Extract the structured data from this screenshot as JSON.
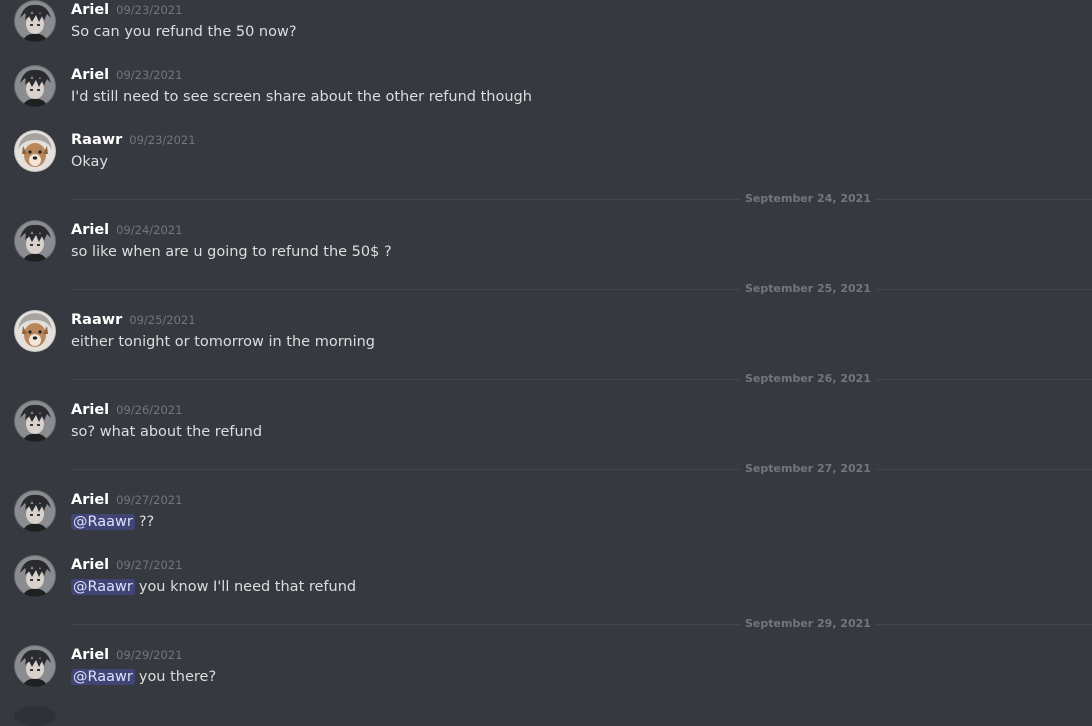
{
  "users": {
    "ariel": "Ariel",
    "raawr": "Raawr"
  },
  "messages": [
    {
      "author": "Ariel",
      "time": "09/23/2021",
      "text": "So can you refund the 50 now?"
    },
    {
      "author": "Ariel",
      "time": "09/23/2021",
      "text": "I'd still need to see screen share about the other refund though"
    },
    {
      "author": "Raawr",
      "time": "09/23/2021",
      "text": "Okay"
    },
    {
      "author": "Ariel",
      "time": "09/24/2021",
      "text": "so like when are u going to refund the 50$ ?"
    },
    {
      "author": "Raawr",
      "time": "09/25/2021",
      "text": "either tonight or tomorrow in the morning"
    },
    {
      "author": "Ariel",
      "time": "09/26/2021",
      "text": "so? what about the refund"
    },
    {
      "author": "Ariel",
      "time": "09/27/2021",
      "mention": "@Raawr",
      "text": "??"
    },
    {
      "author": "Ariel",
      "time": "09/27/2021",
      "mention": "@Raawr",
      "text": "you know I'll need that refund"
    },
    {
      "author": "Ariel",
      "time": "09/29/2021",
      "mention": "@Raawr",
      "text": "you there?"
    }
  ],
  "dividers": [
    "September 24, 2021",
    "September 25, 2021",
    "September 26, 2021",
    "September 27, 2021",
    "September 29, 2021"
  ],
  "colors": {
    "background": "#36393f",
    "username": "#ffffff",
    "message_text": "#dcddde",
    "timestamp": "#72767d",
    "mention_background": "#414675",
    "mention_text": "#dee0fc",
    "divider_line": "#42454a"
  },
  "icons": {
    "ariel_avatar": "anime-boy-avatar-icon",
    "raawr_avatar": "dog-avatar-icon"
  }
}
